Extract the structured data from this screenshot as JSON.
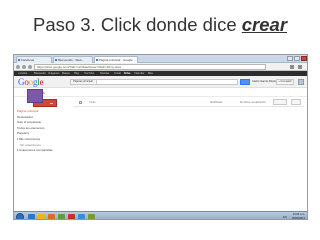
{
  "slide": {
    "title_prefix": "Paso 3. Click donde dice ",
    "title_keyword": "crear"
  },
  "browser": {
    "tabs": [
      {
        "label": "Facebook"
      },
      {
        "label": "Bienvenido - Web..."
      },
      {
        "label": "Página principal - Google ..."
      }
    ],
    "url": "https://sites.google.com/?tab=mo3&authuser=0&pli=1#my-sites"
  },
  "google_bar": {
    "items": [
      "+Carlos",
      "Búsqueda",
      "Imágenes",
      "Mapas",
      "Play",
      "YouTube",
      "Noticias",
      "Gmail",
      "Drive",
      "Calendar",
      "Más"
    ],
    "selected_index": 8
  },
  "header": {
    "logo_letters": [
      {
        "ch": "G",
        "color": "#3369e8"
      },
      {
        "ch": "o",
        "color": "#d50f25"
      },
      {
        "ch": "o",
        "color": "#eeb211"
      },
      {
        "ch": "g",
        "color": "#3369e8"
      },
      {
        "ch": "l",
        "color": "#009925"
      },
      {
        "ch": "e",
        "color": "#d50f25"
      }
    ],
    "search_scope": "Páginas principal",
    "user_name": "Carlos García Montoya",
    "share_label": "+ Compartir"
  },
  "sites": {
    "title": "Sites",
    "column_title": "Título",
    "column_modified": "Modificado",
    "column_view": "Mi última visualización"
  },
  "sidebar": {
    "items": [
      {
        "label": "Página principal",
        "active": true,
        "indent": false
      },
      {
        "label": "Destacados",
        "active": false,
        "indent": false
      },
      {
        "label": "Solo el propietario",
        "active": false,
        "indent": false
      },
      {
        "label": "Todos los elementos",
        "active": false,
        "indent": false
      },
      {
        "label": "Papelera",
        "active": false,
        "indent": false
      },
      {
        "label": "Mis colecciones",
        "active": false,
        "indent": false,
        "arrow": true
      },
      {
        "label": "Sin colecciones",
        "active": false,
        "indent": true
      },
      {
        "label": "Colecciones compartidas",
        "active": false,
        "indent": false,
        "arrow": true
      }
    ]
  },
  "taskbar": {
    "time": "10:05 a.m.",
    "date": "05/05/2013",
    "language": "ES",
    "icon_colors": [
      "#2c78c8",
      "#f3b31b",
      "#e06a1f",
      "#5aa331",
      "#c8302c",
      "#3a8ed8",
      "#7b9a2e"
    ]
  },
  "colors": {
    "accent_red": "#d14836",
    "google_blue": "#4d90fe",
    "gbar": "#2d2d2d",
    "cursor": "#7a5aa8"
  }
}
